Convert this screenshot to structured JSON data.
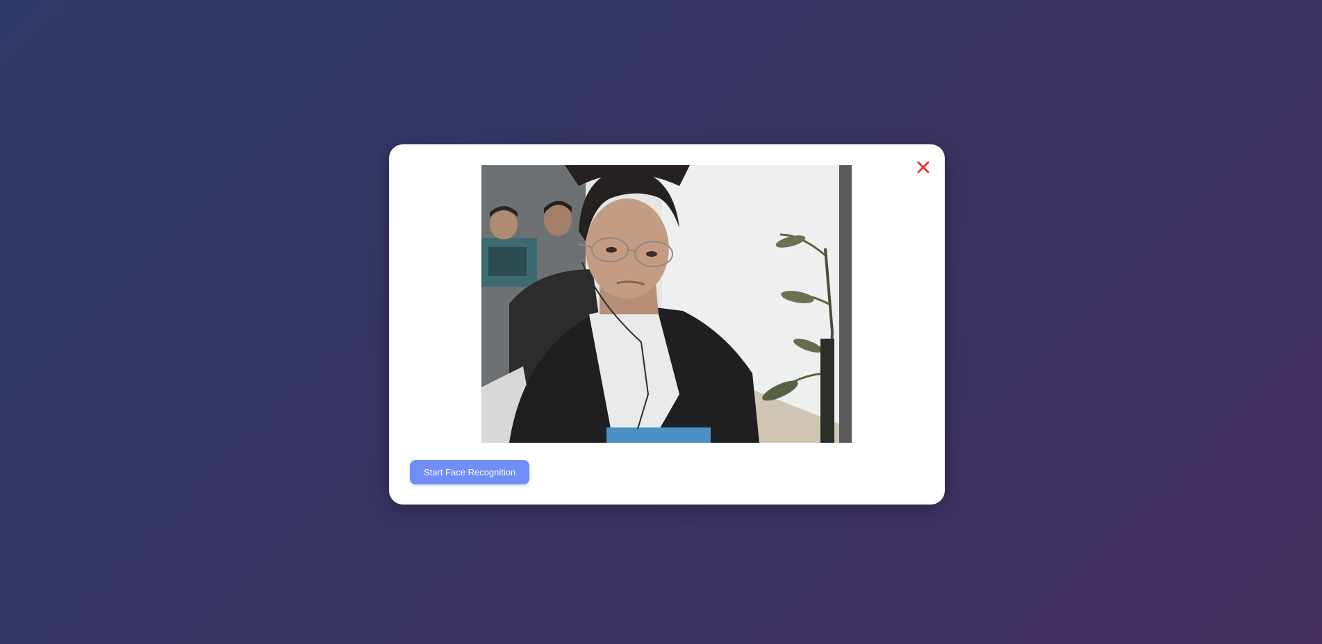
{
  "modal": {
    "close_icon": "close-icon",
    "close_color": "#e53935",
    "camera_feed": "webcam-video",
    "start_button_label": "Start Face Recognition",
    "start_button_color": "#6f8ef7"
  }
}
